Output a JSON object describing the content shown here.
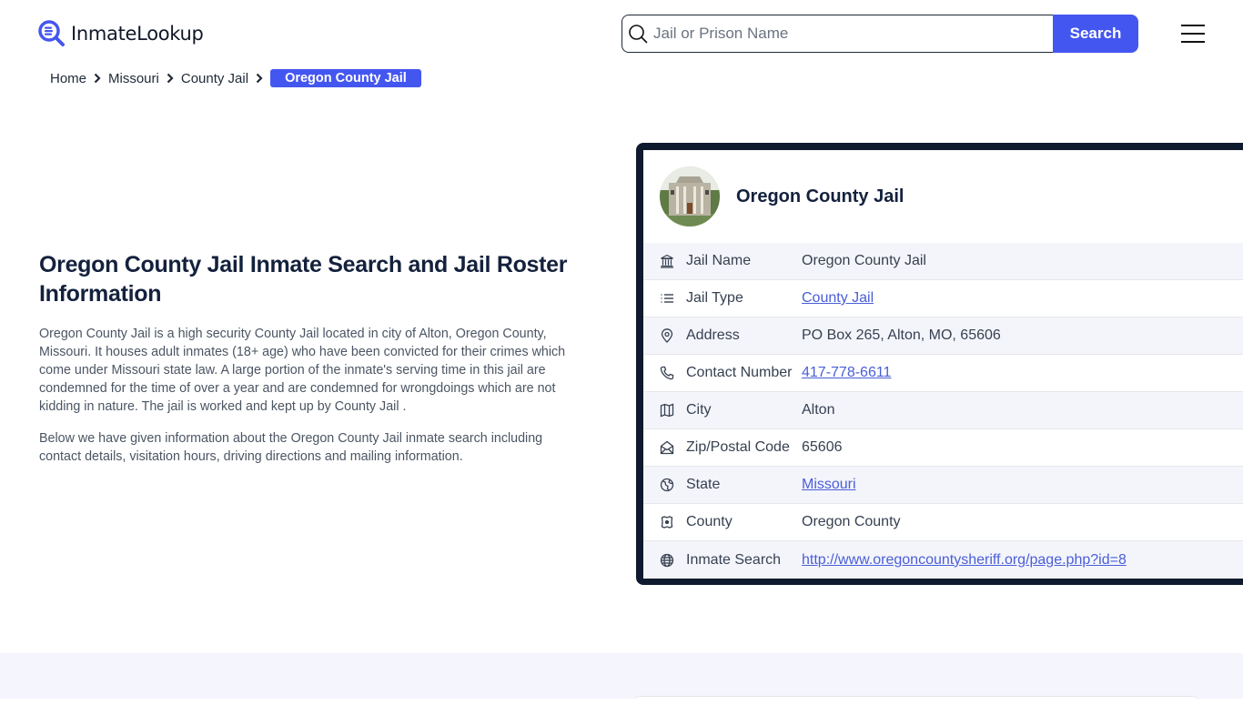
{
  "header": {
    "brand": "InmateLookup",
    "search": {
      "placeholder": "Jail or Prison Name",
      "value": "",
      "button_label": "Search"
    },
    "menu_icon": "hamburger-icon"
  },
  "breadcrumb": [
    {
      "label": "Home"
    },
    {
      "label": "Missouri"
    },
    {
      "label": "County Jail"
    },
    {
      "label": "Oregon County Jail",
      "current": true
    }
  ],
  "intro": {
    "title": "Oregon County Jail Inmate Search and Jail Roster Information",
    "paragraphs": [
      "Oregon County Jail is a high security County Jail located in city of Alton, Oregon County, Missouri. It houses adult inmates (18+ age) who have been convicted for their crimes which come under Missouri state law. A large portion of the inmate's serving time in this jail are condemned for the time of over a year and are condemned for wrongdoings which are not kidding in nature. The jail is worked and kept up by County Jail .",
      "Below we have given information about the Oregon County Jail inmate search including contact details, visitation hours, driving directions and mailing information."
    ]
  },
  "card": {
    "title": "Oregon County Jail",
    "rows": [
      {
        "icon": "building-icon",
        "label": "Jail Name",
        "value": "Oregon County Jail",
        "link": false
      },
      {
        "icon": "list-icon",
        "label": "Jail Type",
        "value": "County Jail",
        "link": true
      },
      {
        "icon": "location-pin-icon",
        "label": "Address",
        "value": "PO Box 265, Alton, MO, 65606",
        "link": false
      },
      {
        "icon": "phone-icon",
        "label": "Contact Number",
        "value": "417-778-6611",
        "link": true
      },
      {
        "icon": "map-icon",
        "label": "City",
        "value": "Alton",
        "link": false
      },
      {
        "icon": "mail-open-icon",
        "label": "Zip/Postal Code",
        "value": "65606",
        "link": false
      },
      {
        "icon": "globe-region-icon",
        "label": "State",
        "value": "Missouri",
        "link": true
      },
      {
        "icon": "map-pin-square-icon",
        "label": "County",
        "value": "Oregon County",
        "link": false
      },
      {
        "icon": "globe-icon",
        "label": "Inmate Search",
        "value": "http://www.oregoncountysheriff.org/page.php?id=8",
        "link": true
      }
    ]
  },
  "colors": {
    "accent": "#4456f0",
    "card_border": "#101a2e",
    "link": "#4a5ed8",
    "row_alt": "#f4f5fb",
    "lower_bg": "#f5f5fe"
  }
}
